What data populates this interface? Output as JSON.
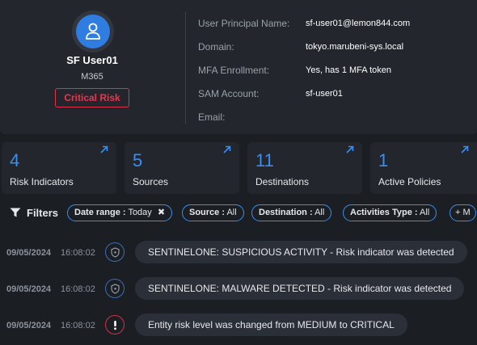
{
  "user": {
    "name": "SF User01",
    "type": "M365",
    "risk_badge": "Critical Risk"
  },
  "details": {
    "upn_label": "User Principal Name:",
    "upn_value": "sf-user01@lemon844.com",
    "domain_label": "Domain:",
    "domain_value": "tokyo.marubeni-sys.local",
    "mfa_label": "MFA Enrollment:",
    "mfa_value": "Yes, has 1 MFA token",
    "sam_label": "SAM Account:",
    "sam_value": "sf-user01",
    "email_label": "Email:",
    "email_value": ""
  },
  "stats": [
    {
      "value": "4",
      "label": "Risk Indicators"
    },
    {
      "value": "5",
      "label": "Sources"
    },
    {
      "value": "11",
      "label": "Destinations"
    },
    {
      "value": "1",
      "label": "Active Policies"
    }
  ],
  "filters": {
    "label": "Filters",
    "chips": [
      {
        "key": "Date range :",
        "value": "Today",
        "close": "✖"
      },
      {
        "key": "Source :",
        "value": "All"
      },
      {
        "key": "Destination :",
        "value": "All"
      },
      {
        "key": "Activities Type :",
        "value": "All"
      }
    ],
    "add_label": "+ M"
  },
  "logs": [
    {
      "date": "09/05/2024",
      "time": "16:08:02",
      "icon": "shield-icon",
      "message": "SENTINELONE: SUSPICIOUS ACTIVITY - Risk indicator was detected"
    },
    {
      "date": "09/05/2024",
      "time": "16:08:02",
      "icon": "shield-icon",
      "message": "SENTINELONE: MALWARE DETECTED - Risk indicator was detected"
    },
    {
      "date": "09/05/2024",
      "time": "16:08:02",
      "icon": "exclamation-icon",
      "message": "Entity risk level was changed from MEDIUM to CRITICAL"
    }
  ],
  "colors": {
    "accent": "#3b8ef0",
    "critical": "#e0304a",
    "panel": "#23272d",
    "background": "#1b1e23"
  }
}
